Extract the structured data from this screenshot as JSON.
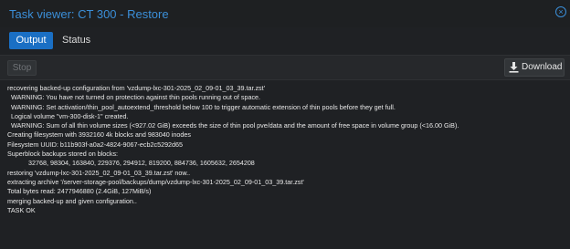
{
  "window": {
    "title": "Task viewer: CT 300 - Restore",
    "close_symbol": "×"
  },
  "tabs": [
    {
      "label": "Output",
      "active": true
    },
    {
      "label": "Status",
      "active": false
    }
  ],
  "toolbar": {
    "stop_label": "Stop",
    "download_label": "Download",
    "download_icon": "download-icon"
  },
  "log": {
    "lines": [
      {
        "text": "recovering backed-up configuration from 'vzdump-lxc-301-2025_02_09-01_03_39.tar.zst'",
        "indent": 0
      },
      {
        "text": "WARNING: You have not turned on protection against thin pools running out of space.",
        "indent": 1
      },
      {
        "text": "WARNING: Set activation/thin_pool_autoextend_threshold below 100 to trigger automatic extension of thin pools before they get full.",
        "indent": 1
      },
      {
        "text": "Logical volume \"vm-300-disk-1\" created.",
        "indent": 1
      },
      {
        "text": "WARNING: Sum of all thin volume sizes (<927.02 GiB) exceeds the size of thin pool pve/data and the amount of free space in volume group (<16.00 GiB).",
        "indent": 1
      },
      {
        "text": "Creating filesystem with 3932160 4k blocks and 983040 inodes",
        "indent": 0
      },
      {
        "text": "Filesystem UUID: b11b903f-a0a2-4824-9067-ecb2c5292d65",
        "indent": 0
      },
      {
        "text": "Superblock backups stored on blocks:",
        "indent": 0
      },
      {
        "text": "32768, 98304, 163840, 229376, 294912, 819200, 884736, 1605632, 2654208",
        "indent": 2
      },
      {
        "text": "restoring 'vzdump-lxc-301-2025_02_09-01_03_39.tar.zst' now..",
        "indent": 0
      },
      {
        "text": "extracting archive '/server-storage-pool/backups/dump/vzdump-lxc-301-2025_02_09-01_03_39.tar.zst'",
        "indent": 0
      },
      {
        "text": "Total bytes read: 2477946880 (2.4GiB, 127MiB/s)",
        "indent": 0
      },
      {
        "text": "merging backed-up and given configuration..",
        "indent": 0
      },
      {
        "text": "TASK OK",
        "indent": 0
      }
    ]
  },
  "colors": {
    "accent": "#3b8fd9",
    "active_tab": "#1a6fc4",
    "background": "#1f2124"
  }
}
